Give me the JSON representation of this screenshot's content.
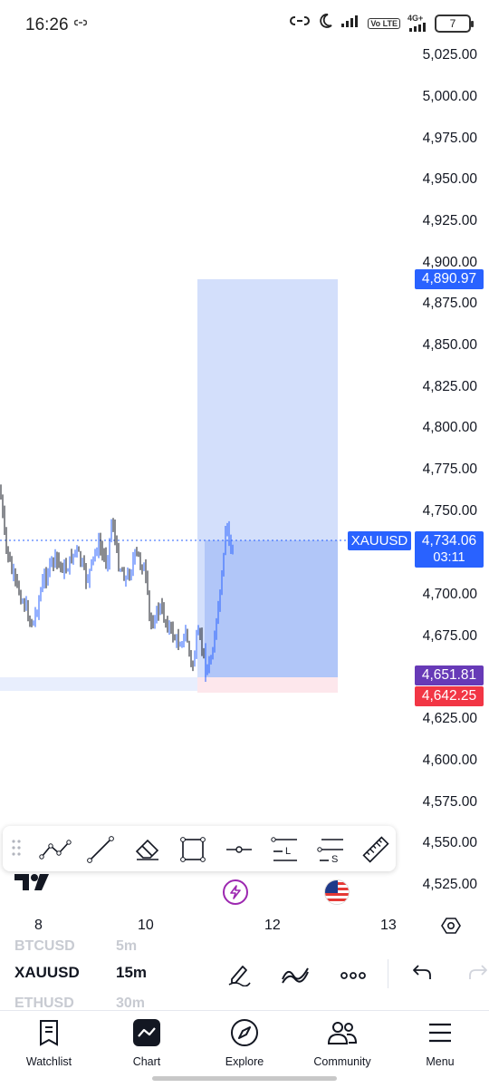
{
  "status_bar": {
    "time": "16:26",
    "battery": "7",
    "network": "4G+",
    "volte": "Vo LTE"
  },
  "chart": {
    "symbol": "XAUUSD",
    "price_axis": [
      "5,025.00",
      "5,000.00",
      "4,975.00",
      "4,950.00",
      "4,925.00",
      "4,900.00",
      "4,875.00",
      "4,850.00",
      "4,825.00",
      "4,800.00",
      "4,775.00",
      "4,750.00",
      "4,700.00",
      "4,675.00",
      "4,625.00",
      "4,600.00",
      "4,575.00",
      "4,550.00",
      "4,525.00"
    ],
    "target_price": "4,890.97",
    "current_price": "4,734.06",
    "countdown": "03:11",
    "entry_price": "4,651.81",
    "stop_price": "4,642.25",
    "dates": [
      "8",
      "10",
      "12",
      "13"
    ],
    "colors": {
      "accent": "#2962ff",
      "entry": "#673ab7",
      "stop": "#f23645",
      "target_zone": "#d1ddfb",
      "stop_zone": "#fde7ec"
    }
  },
  "toolbar": {
    "tools": [
      "trend-line-path-icon",
      "line-icon",
      "eraser-icon",
      "rectangle-icon",
      "horizontal-ray-icon",
      "long-position-icon",
      "short-position-icon",
      "ruler-icon"
    ],
    "long_letter": "L",
    "short_letter": "S"
  },
  "symbol_bar": {
    "prev_symbol": "BTCUSD",
    "prev_interval": "5m",
    "symbol": "XAUUSD",
    "interval": "15m",
    "next_symbol": "ETHUSD",
    "next_interval": "30m"
  },
  "nav": {
    "items": [
      {
        "label": "Watchlist",
        "icon": "watchlist-icon"
      },
      {
        "label": "Chart",
        "icon": "chart-icon"
      },
      {
        "label": "Explore",
        "icon": "compass-icon"
      },
      {
        "label": "Community",
        "icon": "people-icon"
      },
      {
        "label": "Menu",
        "icon": "hamburger-icon"
      }
    ]
  }
}
